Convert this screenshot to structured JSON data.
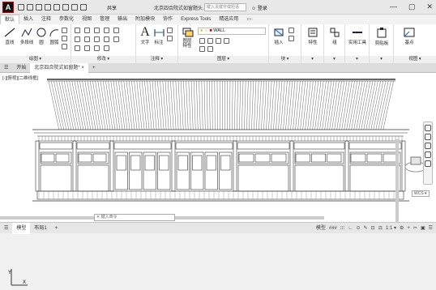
{
  "app": {
    "logo": "A",
    "title": "北京四合院式如窗题头...",
    "search_placeholder": "键入关键字或短语",
    "login": "登录",
    "share_label": "共享",
    "window_controls": [
      "—",
      "▢",
      "✕"
    ]
  },
  "ribbon_tabs": [
    "默认",
    "插入",
    "注释",
    "参数化",
    "视图",
    "管理",
    "输出",
    "附加模块",
    "协作",
    "Express Tools",
    "精选应用",
    "▭·"
  ],
  "ribbon_active": "默认",
  "panels": {
    "draw": {
      "title": "绘图 ▾",
      "tools": [
        "直线",
        "多段线",
        "圆",
        "圆弧"
      ]
    },
    "modify": {
      "title": "修改 ▾"
    },
    "annotation": {
      "title": "注释 ▾",
      "tools": [
        "文字",
        "标注"
      ]
    },
    "layers": {
      "title": "图层 ▾",
      "tools": [
        "图层特性"
      ],
      "layer_name": "WALL"
    },
    "block": {
      "title": "块 ▾",
      "tools": [
        "插入"
      ]
    },
    "properties": {
      "title": "▾",
      "tools": [
        "特性"
      ]
    },
    "groups": {
      "tools": [
        "组"
      ]
    },
    "utilities": {
      "tools": [
        "实用工具"
      ]
    },
    "clipboard": {
      "tools": [
        "剪贴板"
      ]
    },
    "view": {
      "title": "视图 ▾",
      "tools": [
        "基点"
      ]
    }
  },
  "doc_tabs": [
    "开始",
    "北京四合院式如窗题*"
  ],
  "doc_tab_close": "×",
  "doc_tab_add": "+",
  "view_label": "[-][俯视][二维线框]",
  "wcs_label": "WCS ▾",
  "cmd_prompt": "键入命令",
  "layout_tabs": [
    "模型",
    "布局1"
  ],
  "layout_add": "+",
  "status": {
    "model": "模型",
    "grid": "###",
    "snap": "⁝⁝⁝",
    "scale": "1:1",
    "items": [
      "∟",
      "⊙",
      "✎",
      "⊡",
      "⚖",
      "1:1 ▾",
      "⚙",
      "+",
      "✂",
      "▣",
      "☰"
    ]
  },
  "colors": {
    "accent": "#0a64c8",
    "roof": "#333333",
    "bg": "#ffffff"
  }
}
